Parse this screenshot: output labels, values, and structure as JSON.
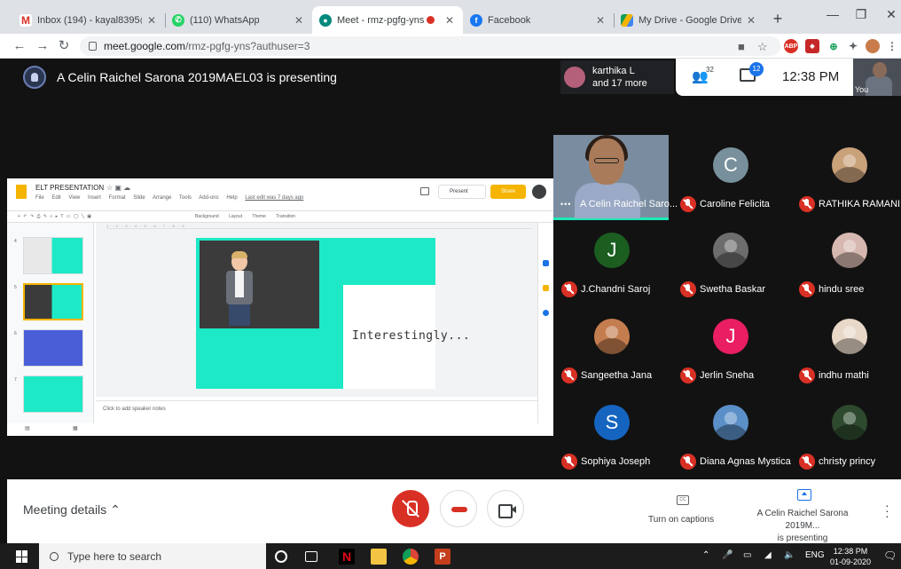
{
  "browser": {
    "tabs": [
      {
        "title": "Inbox (194) - kayal8395@gmai",
        "icon": "gmail-icon",
        "color": "#d93025"
      },
      {
        "title": "(110) WhatsApp",
        "icon": "whatsapp-icon",
        "color": "#25d366"
      },
      {
        "title": "Meet - rmz-pgfg-yns",
        "icon": "meet-icon",
        "color": "#00897b"
      },
      {
        "title": "Facebook",
        "icon": "facebook-icon",
        "color": "#1877f2"
      },
      {
        "title": "My Drive - Google Drive",
        "icon": "drive-icon",
        "color": "#f4b400"
      }
    ],
    "url_host": "meet.google.com",
    "url_path": "/rmz-pgfg-yns?authuser=3"
  },
  "meet": {
    "presenting_banner": "A Celin Raichel Sarona 2019MAEL03 is presenting",
    "people_pill": {
      "line1": "karthika L",
      "line2": "and 17 more"
    },
    "participants_count": "32",
    "chat_badge": "12",
    "time": "12:38 PM",
    "self_label": "You"
  },
  "slides": {
    "doc_title": "ELT PRESENTATION",
    "menus": [
      "File",
      "Edit",
      "View",
      "Insert",
      "Format",
      "Slide",
      "Arrange",
      "Tools",
      "Add-ons",
      "Help"
    ],
    "last_edit": "Last edit was 7 days ago",
    "present_label": "Present",
    "share_label": "Share",
    "toolbar_named": [
      "Background",
      "Layout",
      "Theme",
      "Transition"
    ],
    "thumb_numbers": [
      "4",
      "5",
      "6",
      "7"
    ],
    "slide_text": "Interestingly...",
    "speaker_notes": "Click to add speaker notes",
    "ruler": "1 · · · 2 · · · 3 · · · 4 · · · 5 · · · 6 · · · 7 · · · 8 · · · 9"
  },
  "participants": [
    {
      "name": "A Celin Raichel Saro...",
      "featured": true
    },
    {
      "name": "Caroline Felicita",
      "initial": "C",
      "color": "#78909c"
    },
    {
      "name": "RATHIKA RAMANI",
      "photo": true,
      "color": "#c9a27a"
    },
    {
      "name": "J.Chandni Saroj",
      "initial": "J",
      "color": "#1b5e20"
    },
    {
      "name": "Swetha Baskar",
      "photo": true,
      "color": "#6d6d6d"
    },
    {
      "name": "hindu sree",
      "photo": true,
      "color": "#d7b8b0"
    },
    {
      "name": "Sangeetha Jana",
      "photo": true,
      "color": "#c47d4f"
    },
    {
      "name": "Jerlin Sneha",
      "initial": "J",
      "color": "#e91e63"
    },
    {
      "name": "indhu mathi",
      "photo": true,
      "color": "#e8d8c8"
    },
    {
      "name": "Sophiya Joseph",
      "initial": "S",
      "color": "#1565c0"
    },
    {
      "name": "Diana Agnas Mystica",
      "photo": true,
      "color": "#5b8fc8"
    },
    {
      "name": "christy princy",
      "photo": true,
      "color": "#2e4a2e"
    }
  ],
  "controls": {
    "meeting_details": "Meeting details",
    "captions_label": "Turn on captions",
    "cc": "CC",
    "presenting_line1": "A Celin Raichel Sarona 2019M...",
    "presenting_line2": "is presenting"
  },
  "taskbar": {
    "search_placeholder": "Type here to search",
    "lang": "ENG",
    "clock_time": "12:38 PM",
    "clock_date": "01-09-2020"
  }
}
